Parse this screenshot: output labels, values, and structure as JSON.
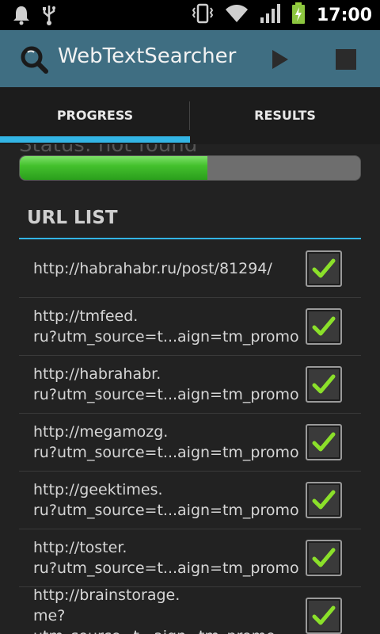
{
  "status_bar": {
    "time": "17:00",
    "icons": [
      "bell-icon",
      "usb-icon",
      "vibrate-icon",
      "wifi-icon",
      "signal-icon",
      "battery-charging-icon"
    ]
  },
  "action_bar": {
    "title": "WebTextSearcher",
    "logo_icon": "search-logo-icon",
    "actions": [
      "play-icon",
      "stop-icon"
    ]
  },
  "tabs": [
    {
      "label": "PROGRESS",
      "selected": true
    },
    {
      "label": "RESULTS",
      "selected": false
    }
  ],
  "progress": {
    "status_text": "Status: not found",
    "value_fraction": 0.55
  },
  "url_list": {
    "header": "URL LIST",
    "items": [
      {
        "url": "http://habrahabr.ru/post/81294/",
        "checked": true
      },
      {
        "url": "http://tmfeed.\nru?utm_source=t...aign=tm_promo",
        "checked": true
      },
      {
        "url": "http://habrahabr.\nru?utm_source=t...aign=tm_promo",
        "checked": true
      },
      {
        "url": "http://megamozg.\nru?utm_source=t...aign=tm_promo",
        "checked": true
      },
      {
        "url": "http://geektimes.\nru?utm_source=t...aign=tm_promo",
        "checked": true
      },
      {
        "url": "http://toster.\nru?utm_source=t...aign=tm_promo",
        "checked": true
      },
      {
        "url": "http://brainstorage.\nme?utm_source=t...aign=tm_promo",
        "checked": true
      }
    ]
  },
  "colors": {
    "action_bar": "#3f6e82",
    "accent": "#33b5e5",
    "progress_green": "#44c12d",
    "check_green": "#8be02a"
  }
}
